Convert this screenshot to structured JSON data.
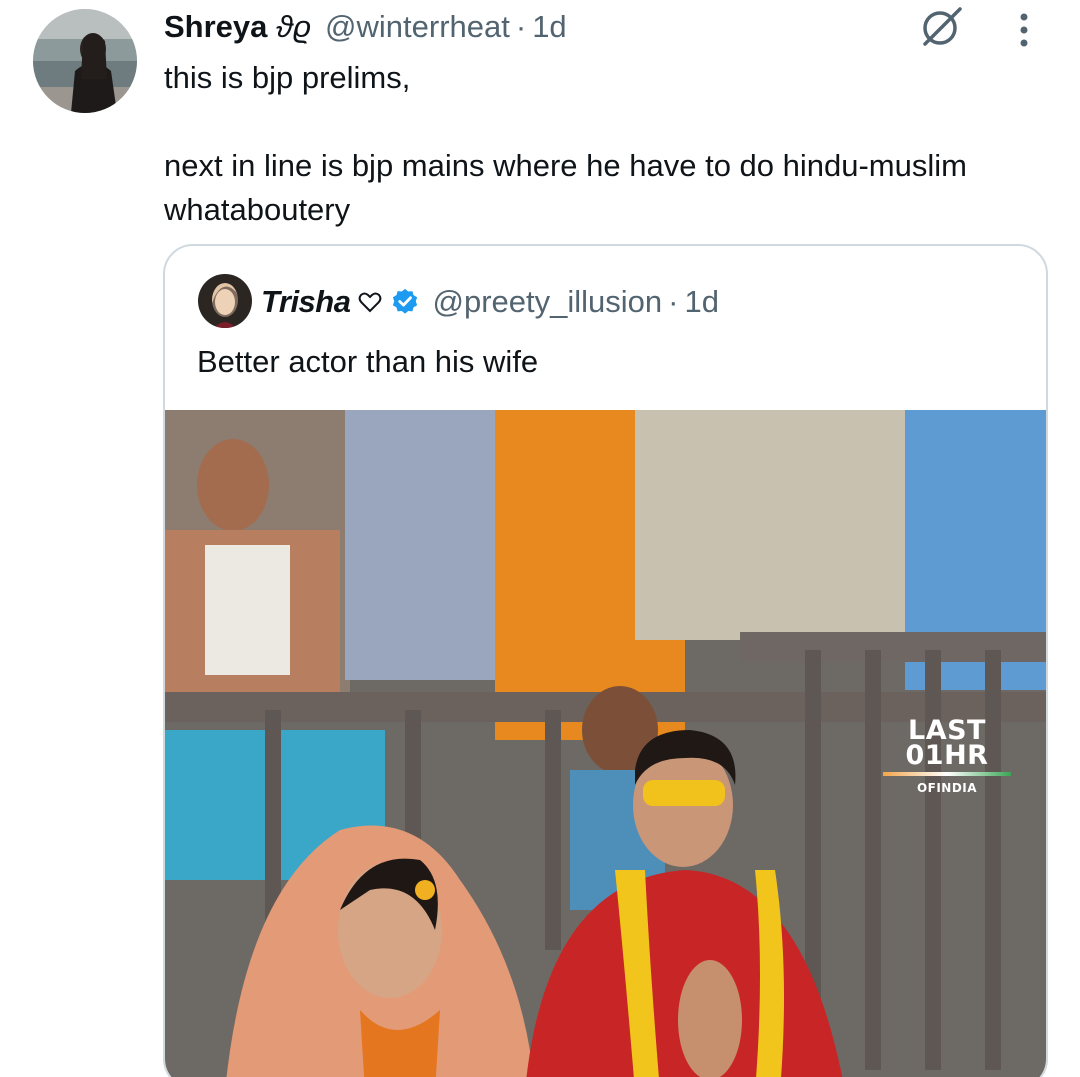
{
  "tweet": {
    "display_name": "Shreya",
    "name_glyph": "ϑϱ",
    "handle": "@winterrheat",
    "separator": "·",
    "time": "1d",
    "text_lines": [
      "this is bjp prelims,",
      "",
      "next in line is bjp mains where he have to do hindu-muslim",
      "whataboutery"
    ],
    "icons": {
      "avatar": "avatar",
      "grok": "grok-icon",
      "more": "more-icon"
    }
  },
  "quote": {
    "display_name": "Trisha",
    "heart": "♡",
    "verified": true,
    "handle": "@preety_illusion",
    "separator": "·",
    "time": "1d",
    "text": "Better actor than his wife",
    "media": {
      "watermark_line1": "LAST",
      "watermark_line2": "01HR",
      "watermark_sub": "OFINDIA"
    }
  },
  "colors": {
    "text": "#0f1419",
    "secondary": "#536471",
    "border": "#cfd9de",
    "verified": "#1d9bf0"
  }
}
